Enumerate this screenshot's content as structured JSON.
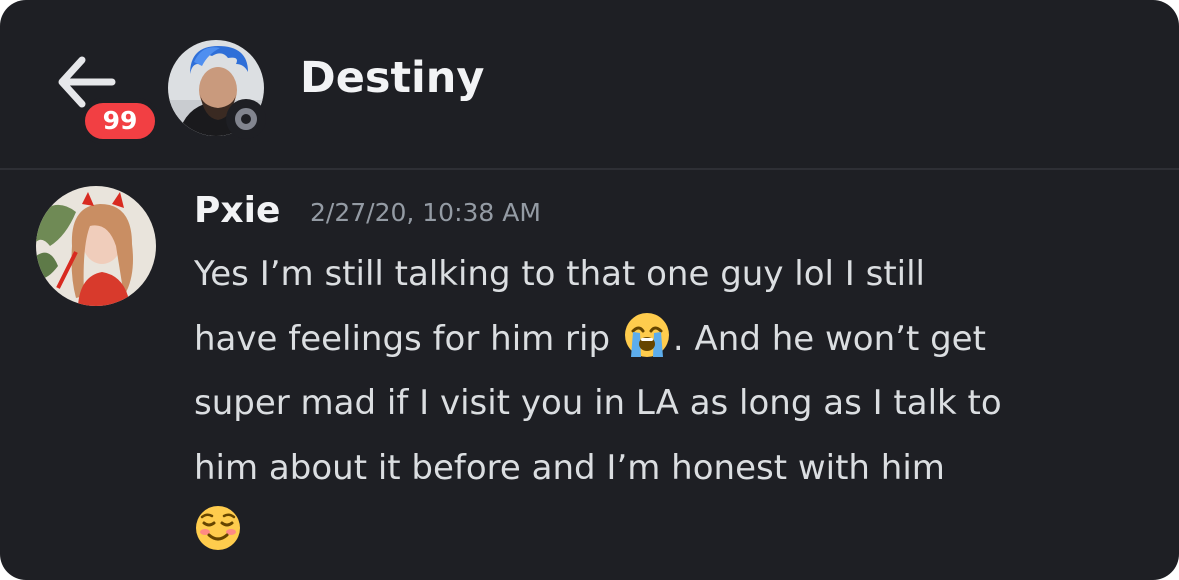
{
  "header": {
    "back_icon": "arrow-left-icon",
    "unread_count": "99",
    "title": "Destiny",
    "status": "offline",
    "badge_color": "#f23f43"
  },
  "message": {
    "author": "Pxie",
    "timestamp": "2/27/20, 10:38 AM",
    "lines": [
      "Yes I’m still talking to that one guy lol I still",
      "have feelings for him rip",
      ". And he won’t get",
      "super mad if I visit you in LA as long as I talk to",
      "him about it before and I’m honest with him"
    ],
    "emojis": [
      "loudly-crying-face-emoji",
      "smiling-face-emoji"
    ]
  },
  "colors": {
    "background": "#1e1f24",
    "text_primary": "#f2f3f5",
    "text_body": "#dbdee1",
    "text_muted": "#949ba4"
  }
}
